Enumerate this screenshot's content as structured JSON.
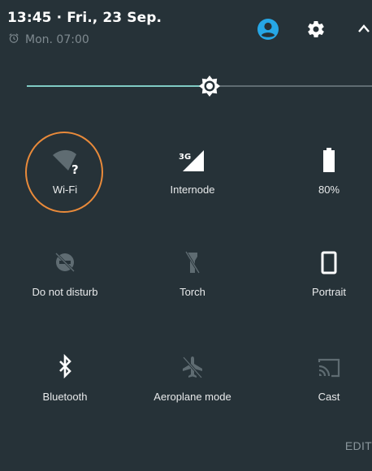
{
  "header": {
    "time_date": "13:45 · Fri., 23 Sep.",
    "alarm_text": "Mon. 07:00"
  },
  "colors": {
    "background": "#263238",
    "accent": "#80cbc4",
    "user_icon": "#26a7e6",
    "annotation": "#e98a3a",
    "inactive_icon": "#5f6c72"
  },
  "tiles": [
    {
      "label": "Wi-Fi",
      "icon": "wifi-unknown-icon"
    },
    {
      "label": "Internode",
      "icon": "mobile-signal-3g-icon"
    },
    {
      "label": "80%",
      "icon": "battery-icon"
    },
    {
      "label": "Do not disturb",
      "icon": "do-not-disturb-icon"
    },
    {
      "label": "Torch",
      "icon": "torch-off-icon"
    },
    {
      "label": "Portrait",
      "icon": "portrait-rotation-icon"
    },
    {
      "label": "Bluetooth",
      "icon": "bluetooth-icon"
    },
    {
      "label": "Aeroplane mode",
      "icon": "aeroplane-off-icon"
    },
    {
      "label": "Cast",
      "icon": "cast-icon"
    }
  ],
  "signal_badge": "3G",
  "wifi_badge": "?",
  "edit_label": "EDIT"
}
